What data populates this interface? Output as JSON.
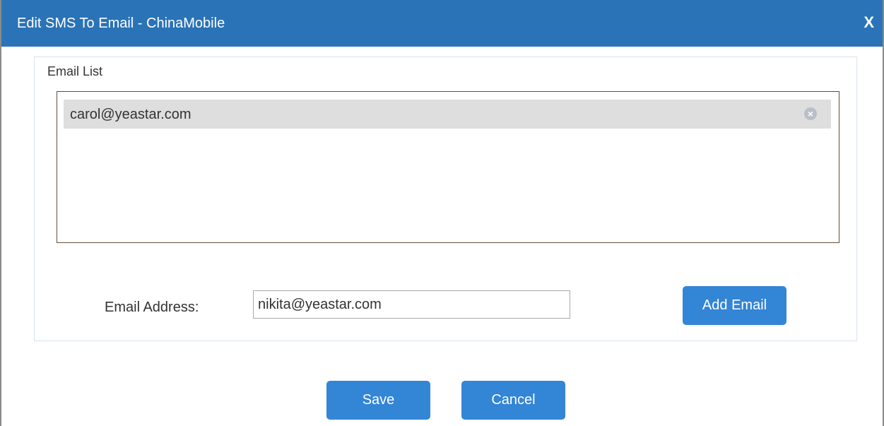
{
  "dialog": {
    "title": "Edit SMS To Email - ChinaMobile",
    "close_label": "X"
  },
  "email_list": {
    "label": "Email List",
    "items": [
      {
        "address": "carol@yeastar.com",
        "remove_icon": "remove-circle-icon"
      }
    ]
  },
  "email_address": {
    "label": "Email Address:",
    "value": "nikita@yeastar.com"
  },
  "buttons": {
    "add_email": "Add Email",
    "save": "Save",
    "cancel": "Cancel"
  },
  "colors": {
    "titlebar": "#2a73b6",
    "button": "#3385d6",
    "list_item_bg": "#dedede"
  }
}
